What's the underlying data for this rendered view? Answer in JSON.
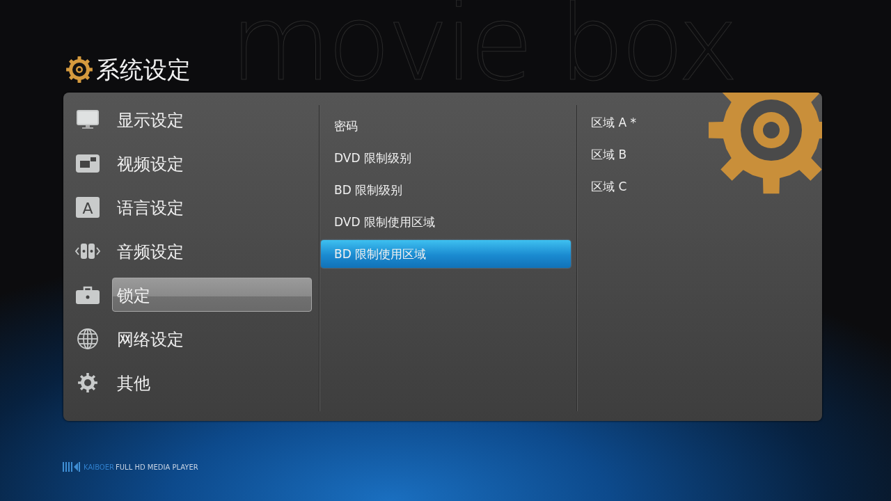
{
  "backdrop_text": "movie box",
  "title": "系统设定",
  "categories": [
    {
      "label": "显示设定",
      "selected": false
    },
    {
      "label": "视频设定",
      "selected": false
    },
    {
      "label": "语言设定",
      "selected": false,
      "icon_text": "A"
    },
    {
      "label": "音频设定",
      "selected": false
    },
    {
      "label": "锁定",
      "selected": true
    },
    {
      "label": "网络设定",
      "selected": false
    },
    {
      "label": "其他",
      "selected": false
    }
  ],
  "options": [
    {
      "label": "密码",
      "selected": false
    },
    {
      "label": "DVD 限制级别",
      "selected": false
    },
    {
      "label": "BD 限制级别",
      "selected": false
    },
    {
      "label": "DVD 限制使用区域",
      "selected": false
    },
    {
      "label": "BD 限制使用区域",
      "selected": true
    }
  ],
  "values": [
    {
      "label": "区域 A *"
    },
    {
      "label": "区域 B"
    },
    {
      "label": "区域 C"
    }
  ],
  "brand": {
    "name": "KAIBOER",
    "tagline": "FULL HD MEDIA PLAYER"
  }
}
